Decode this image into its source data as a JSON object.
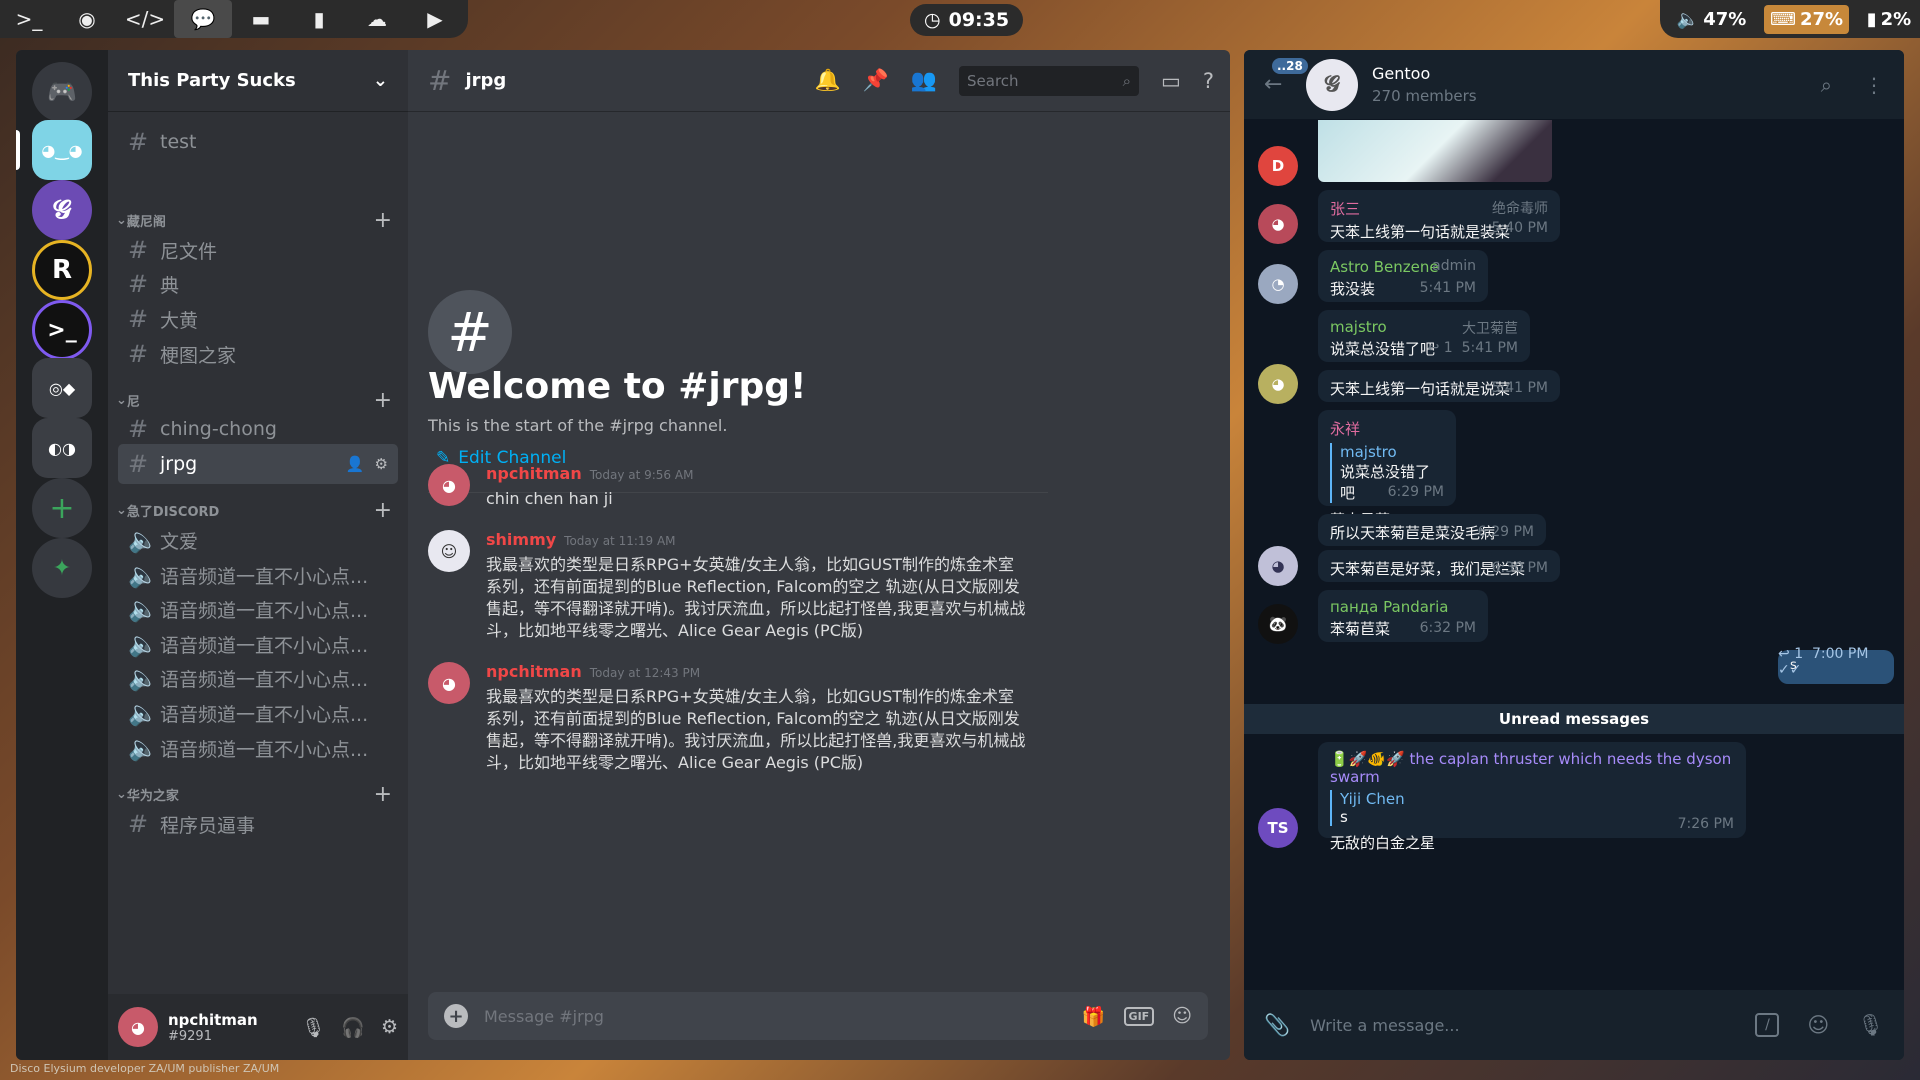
{
  "topbar": {
    "icons": [
      "terminal-icon",
      "firefox-icon",
      "code-icon",
      "chat-icon",
      "folder-icon",
      "book-icon",
      "cloud-icon",
      "media-play-icon"
    ],
    "clock": "09:35",
    "volume": "47%",
    "keyboard_battery": "27%",
    "battery": "2%"
  },
  "discord": {
    "guild_name": "This Party Sucks",
    "channels": [
      {
        "label": "test",
        "type": "text"
      }
    ],
    "categories": [
      {
        "label": "藏尼阁",
        "channels": [
          "尼文件",
          "典",
          "大黄",
          "梗图之家"
        ]
      },
      {
        "label": "尼",
        "channels": [
          "ching-chong",
          "jrpg"
        ]
      },
      {
        "label": "急了DISCORD",
        "voice": [
          "文爱",
          "语音频道一直不小心点...",
          "语音频道一直不小心点...",
          "语音频道一直不小心点...",
          "语音频道一直不小心点...",
          "语音频道一直不小心点...",
          "语音频道一直不小心点..."
        ]
      },
      {
        "label": "华为之家",
        "channels": [
          "程序员逼事"
        ]
      }
    ],
    "active_channel": "jrpg",
    "search_placeholder": "Search",
    "welcome_title": "Welcome to #jrpg!",
    "welcome_sub": "This is the start of the #jrpg channel.",
    "edit_channel": "Edit Channel",
    "messages": [
      {
        "author": "npchitman",
        "color": "#f04747",
        "time": "Today at 9:56 AM",
        "body": "chin chen han ji"
      },
      {
        "author": "shimmy",
        "color": "#f04747",
        "time": "Today at 11:19 AM",
        "body": "我最喜欢的类型是日系RPG+女英雄/女主人翁，比如GUST制作的炼金术室系列，还有前面提到的Blue Reflection, Falcom的空之 轨迹(从日文版刚发售起，等不得翻译就开啃)。我讨厌流血，所以比起打怪兽,我更喜欢与机械战斗，比如地平线零之曙光、Alice Gear Aegis (PC版)"
      },
      {
        "author": "npchitman",
        "color": "#f04747",
        "time": "Today at 12:43 PM",
        "body": "我最喜欢的类型是日系RPG+女英雄/女主人翁，比如GUST制作的炼金术室系列，还有前面提到的Blue Reflection, Falcom的空之 轨迹(从日文版刚发售起，等不得翻译就开啃)。我讨厌流血，所以比起打怪兽,我更喜欢与机械战斗，比如地平线零之曙光、Alice Gear Aegis (PC版)"
      }
    ],
    "composer_placeholder": "Message #jrpg",
    "user": {
      "name": "npchitman",
      "tag": "#9291"
    }
  },
  "telegram": {
    "unread_badge": "..28",
    "title": "Gentoo",
    "subtitle": "270 members",
    "messages": [
      {
        "name": "张三",
        "name_color": "#e06c9f",
        "role": "绝命毒师",
        "text": "天苯上线第一句话就是装菜",
        "time": "5:40 PM"
      },
      {
        "name": "Astro Benzene",
        "name_color": "#7bc862",
        "role": "admin",
        "text": "我没装",
        "time": "5:41 PM"
      },
      {
        "name": "majstro",
        "name_color": "#7bc862",
        "role": "大卫菊苣",
        "text": "说菜总没错了吧",
        "replies": "1",
        "time": "5:41 PM"
      },
      {
        "text": "天苯上线第一句话就是说菜",
        "time": "5:41 PM"
      },
      {
        "name": "永祥",
        "name_color": "#e06c9f",
        "quote_name": "majstro",
        "quote_text": "说菜总没错了吧",
        "text": "菊本是菜",
        "time": "6:29 PM"
      },
      {
        "text": "所以天苯菊苣是菜没毛病",
        "time": "6:29 PM"
      },
      {
        "text": "天苯菊苣是好菜，我们是烂菜",
        "time": "6:30 PM"
      },
      {
        "name": "панда Pandaria",
        "name_color": "#7bc862",
        "text": "苯菊苣菜",
        "time": "6:32 PM"
      }
    ],
    "own_message": {
      "text": "s",
      "replies": "1",
      "time": "7:00 PM"
    },
    "unread_label": "Unread messages",
    "last_message": {
      "link_text": "the caplan thruster which needs the dyson swarm",
      "quote_name": "Yiji Chen",
      "quote_text": "s",
      "text": "无敌的白金之星",
      "time": "7:26 PM",
      "avatar_initials": "TS"
    },
    "avatar_d": "D",
    "composer_placeholder": "Write a message..."
  },
  "footer": "Disco Elysium developer ZA/UM publisher ZA/UM"
}
